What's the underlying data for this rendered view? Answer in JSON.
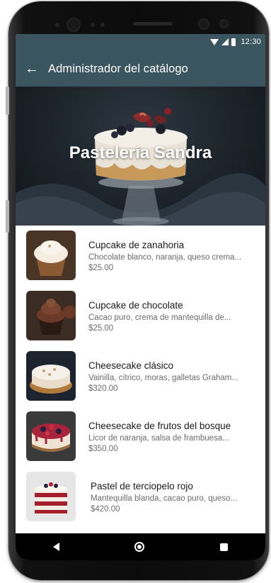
{
  "status_bar": {
    "time": "12:30"
  },
  "app_bar": {
    "title": "Administrador del catálogo",
    "back_icon": "arrow-back-icon"
  },
  "hero": {
    "title": "Pastelería Sandra"
  },
  "products": [
    {
      "name": "Cupcake de zanahoria",
      "description": "Chocolate blanco, naranja, queso crema...",
      "price": "$25.00"
    },
    {
      "name": "Cupcake de chocolate",
      "description": "Cacao puro, crema de mantequilla de...",
      "price": "$25.00"
    },
    {
      "name": "Cheesecake clásico",
      "description": "Vainilla, cítrico, moras, galletas Graham...",
      "price": "$320.00"
    },
    {
      "name": "Cheesecake de frutos del bosque",
      "description": "Licor de naranja, salsa de frambuesa...",
      "price": "$350.00"
    },
    {
      "name": "Pastel de terciopelo rojo",
      "description": "Mantequilla blanda, cacao puro, queso...",
      "price": "$420.00"
    }
  ],
  "colors": {
    "app_bar": "#3a5560",
    "nav_bar": "#000000"
  }
}
